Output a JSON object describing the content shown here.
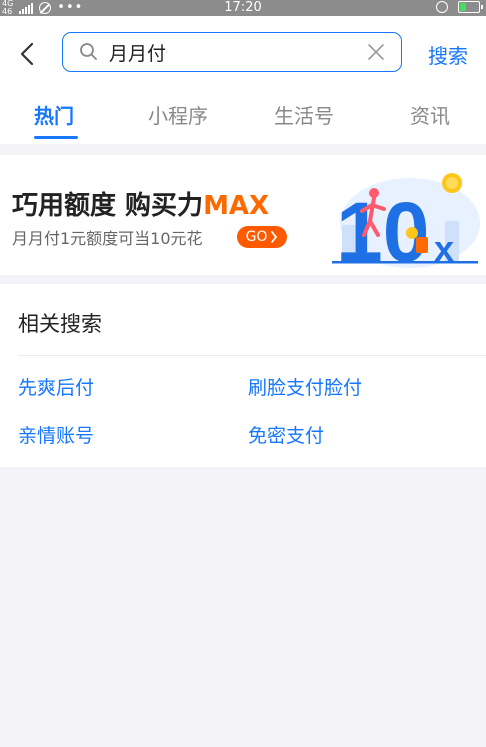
{
  "status_bar": {
    "network": "4G",
    "network_sub": "46",
    "more_dots": "•••",
    "time": "17:20"
  },
  "search": {
    "query": "月月付",
    "button_label": "搜索"
  },
  "tabs": [
    {
      "label": "热门",
      "active": true
    },
    {
      "label": "小程序",
      "active": false
    },
    {
      "label": "生活号",
      "active": false
    },
    {
      "label": "资讯",
      "active": false
    }
  ],
  "banner": {
    "title_main": "巧用额度 购买力",
    "title_accent": "MAX",
    "subtitle": "月月付1元额度可当10元花",
    "go_label": "GO",
    "art_number": "10",
    "art_suffix": "x"
  },
  "related": {
    "title": "相关搜索",
    "items": [
      "先爽后付",
      "刷脸支付脸付",
      "亲情账号",
      "免密支付"
    ]
  },
  "colors": {
    "accent": "#1677ff",
    "go_button": "#ff5a00",
    "max_text": "#ff6a00",
    "status_bar": "#8c8c8c",
    "page_bg": "#f2f2f7"
  }
}
